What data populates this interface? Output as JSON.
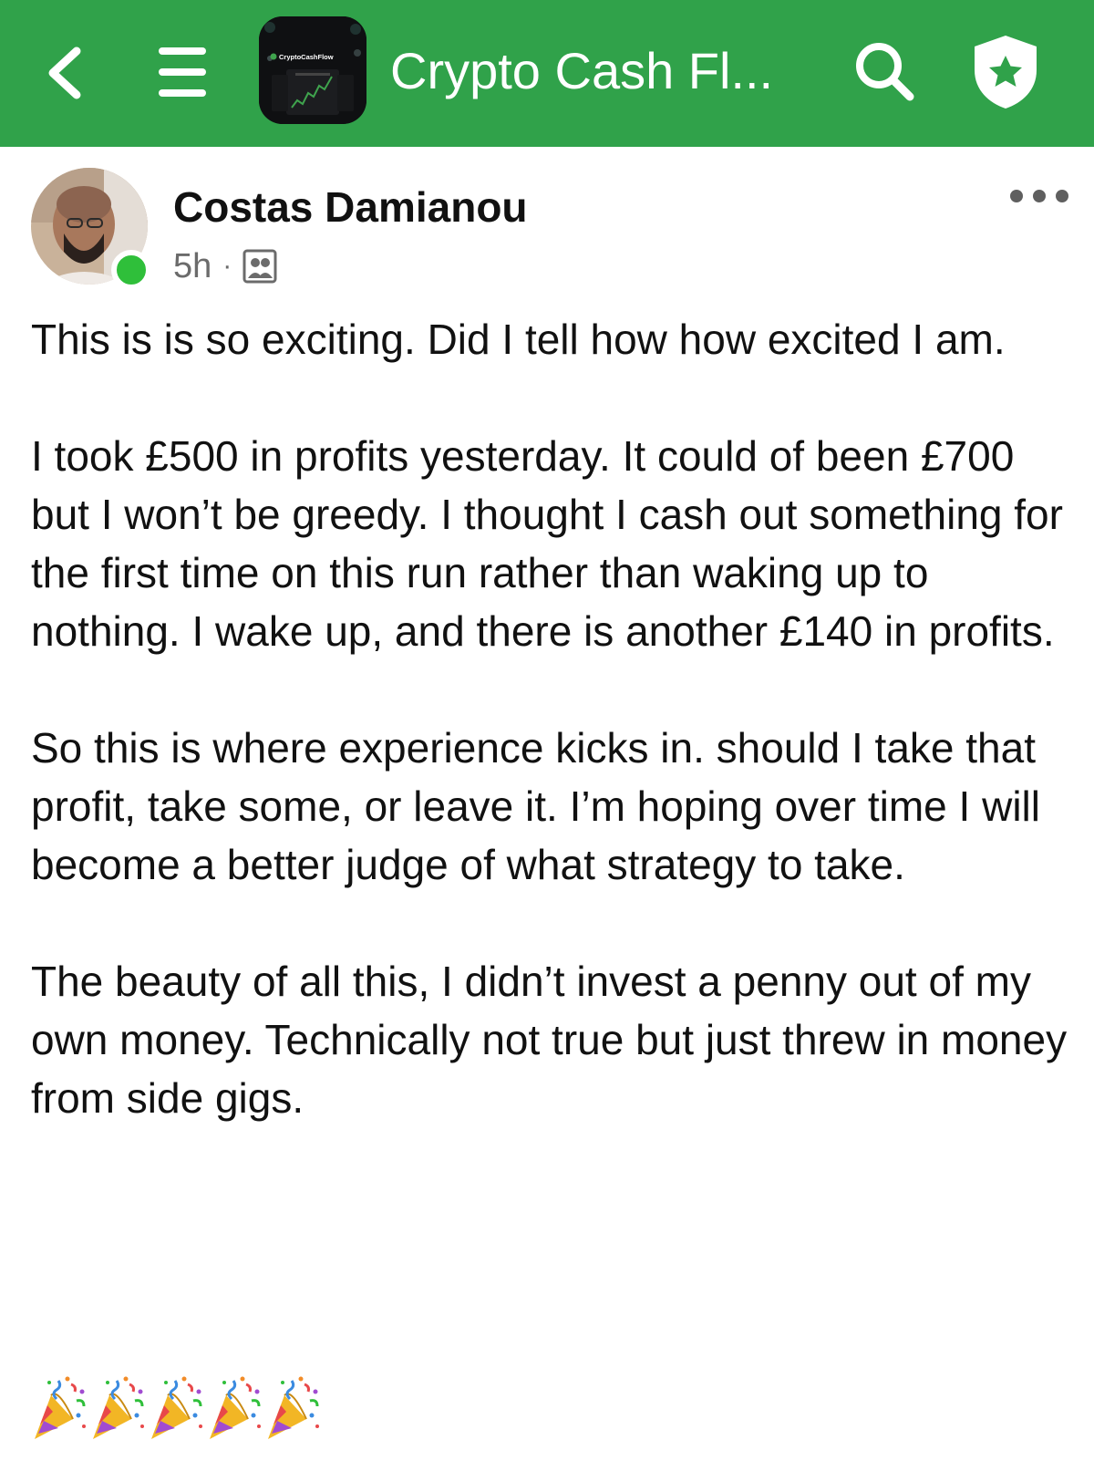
{
  "header": {
    "group_title": "Crypto Cash Fl...",
    "thumb_brand": "CryptoCashFlow",
    "bar_color": "#30a24a"
  },
  "post": {
    "author": "Costas Damianou",
    "time": "5h",
    "separator": "·",
    "audience_icon": "group-privacy-icon",
    "paragraphs": [
      "This is is so exciting. Did I tell how how excited I am.",
      "I took £500 in profits yesterday. It could of been £700 but I won’t be greedy. I thought I cash out something for the first time on this run rather than waking up to nothing. I wake up, and there is another £140 in profits.",
      "So this is where experience kicks in. should I take that profit, take some, or leave it. I’m hoping over time I will become a better judge of what strategy to take.",
      "The beauty of all this, I didn’t invest a penny out of my own money. Technically not true but just threw in money from side gigs."
    ],
    "emoji": [
      "party-popper",
      "party-popper",
      "party-popper",
      "party-popper",
      "party-popper"
    ]
  },
  "icons": {
    "back": "chevron-left-icon",
    "menu": "hamburger-menu-icon",
    "search": "search-icon",
    "shield": "shield-star-icon",
    "more": "more-options-icon"
  }
}
